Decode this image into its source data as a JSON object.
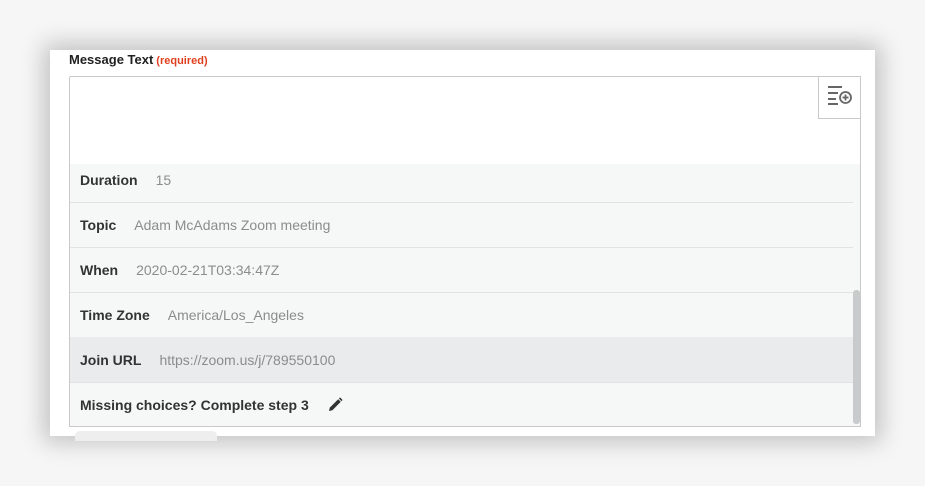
{
  "field": {
    "label": "Message Text",
    "required_label": "(required)",
    "value": ""
  },
  "insert_button": {
    "icon": "insert-data-icon"
  },
  "dropdown": {
    "options": [
      {
        "key": "Duration",
        "value": "15"
      },
      {
        "key": "Topic",
        "value": "Adam McAdams Zoom meeting"
      },
      {
        "key": "When",
        "value": "2020-02-21T03:34:47Z"
      },
      {
        "key": "Time Zone",
        "value": "America/Los_Angeles"
      },
      {
        "key": "Join URL",
        "value": "https://zoom.us/j/789550100"
      }
    ],
    "missing_text": "Missing choices? Complete step 3",
    "missing_icon": "pencil-icon"
  },
  "colors": {
    "required": "#e0401f",
    "highlight": "#e9ebed",
    "dropdown_bg": "#f6f7f7"
  }
}
